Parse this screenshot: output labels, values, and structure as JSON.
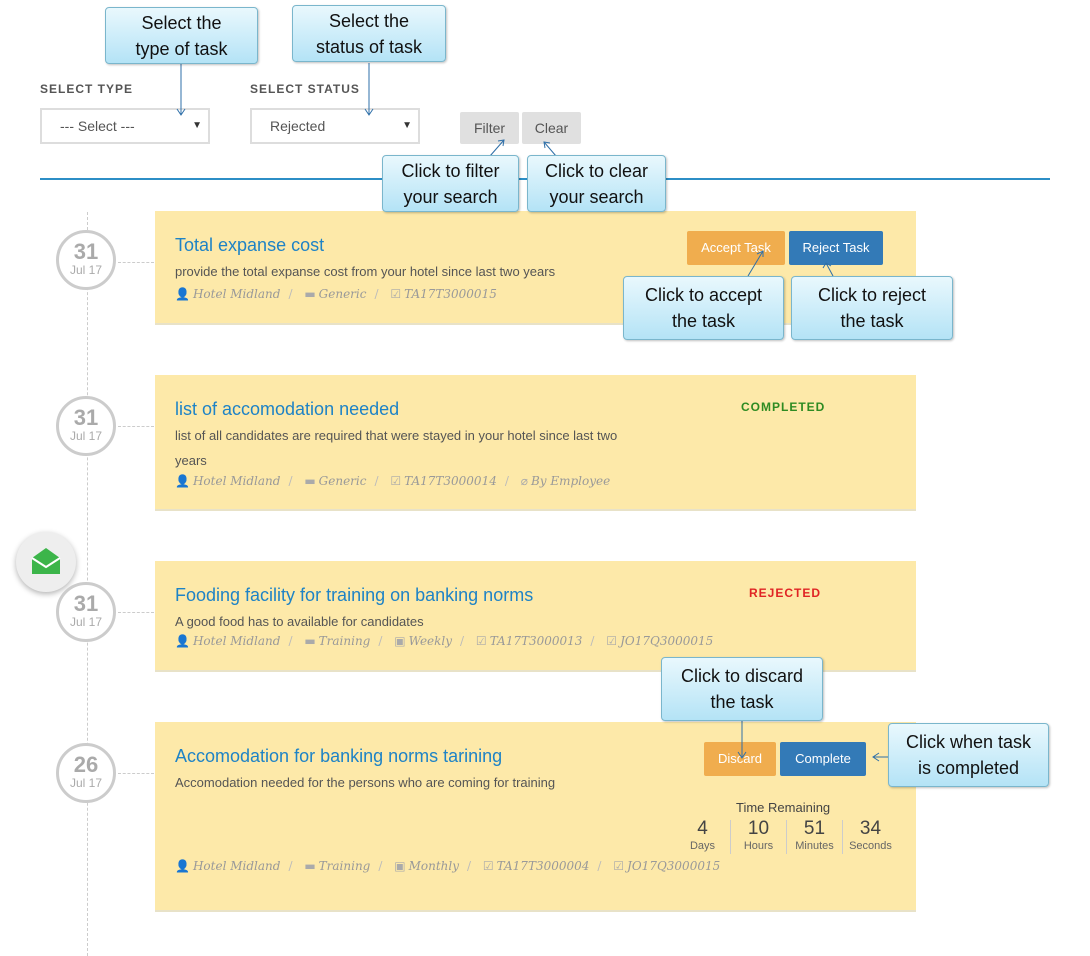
{
  "filters": {
    "type_label": "SELECT TYPE",
    "type_value": "--- Select ---",
    "status_label": "SELECT STATUS",
    "status_value": "Rejected",
    "filter_button": "Filter",
    "clear_button": "Clear"
  },
  "tasks": [
    {
      "day": "31",
      "month": "Jul 17",
      "title": "Total expanse cost",
      "description": "provide the total expanse cost from your hotel since last two years",
      "meta": [
        "Hotel Midland",
        "Generic",
        "TA17T3000015"
      ],
      "accept_label": "Accept Task",
      "reject_label": "Reject Task"
    },
    {
      "day": "31",
      "month": "Jul 17",
      "title": "list of accomodation needed",
      "description_line1": "list of all candidates are required that were stayed in your hotel since last two",
      "description_line2": "years",
      "meta": [
        "Hotel Midland",
        "Generic",
        "TA17T3000014",
        "By Employee"
      ],
      "status": "COMPLETED"
    },
    {
      "day": "31",
      "month": "Jul 17",
      "title": "Fooding facility for training on banking norms",
      "description": "A good food has to available for candidates",
      "meta": [
        "Hotel Midland",
        "Training",
        "Weekly",
        "TA17T3000013",
        "JO17Q3000015"
      ],
      "status": "REJECTED"
    },
    {
      "day": "26",
      "month": "Jul 17",
      "title": "Accomodation for banking norms tarining",
      "description": "Accomodation needed for the persons who are coming for training",
      "meta": [
        "Hotel Midland",
        "Training",
        "Monthly",
        "TA17T3000004",
        "JO17Q3000015"
      ],
      "discard_label": "Discard",
      "complete_label": "Complete",
      "time_remaining_label": "Time Remaining",
      "countdown": [
        {
          "value": "4",
          "unit": "Days"
        },
        {
          "value": "10",
          "unit": "Hours"
        },
        {
          "value": "51",
          "unit": "Minutes"
        },
        {
          "value": "34",
          "unit": "Seconds"
        }
      ]
    }
  ],
  "callouts": {
    "select_type_1": "Select the",
    "select_type_2": "type of task",
    "select_status_1": "Select the",
    "select_status_2": "status of task",
    "filter_1": "Click to filter",
    "filter_2": "your search",
    "clear_1": "Click to clear",
    "clear_2": "your search",
    "accept_1": "Click to accept",
    "accept_2": "the task",
    "reject_1": "Click to reject",
    "reject_2": "the task",
    "discard_1": "Click to discard",
    "discard_2": "the task",
    "complete_1": "Click when task",
    "complete_2": "is completed"
  },
  "colors": {
    "accent": "#1e83c6",
    "card": "#fde9a9",
    "completed": "#2e8b22",
    "rejected": "#e02424",
    "orange": "#f0ad4e",
    "blue": "#337ab7"
  },
  "icons": [
    "user-icon",
    "folder-icon",
    "check-square-icon",
    "paperclip-icon",
    "calendar-icon",
    "envelope-icon"
  ]
}
